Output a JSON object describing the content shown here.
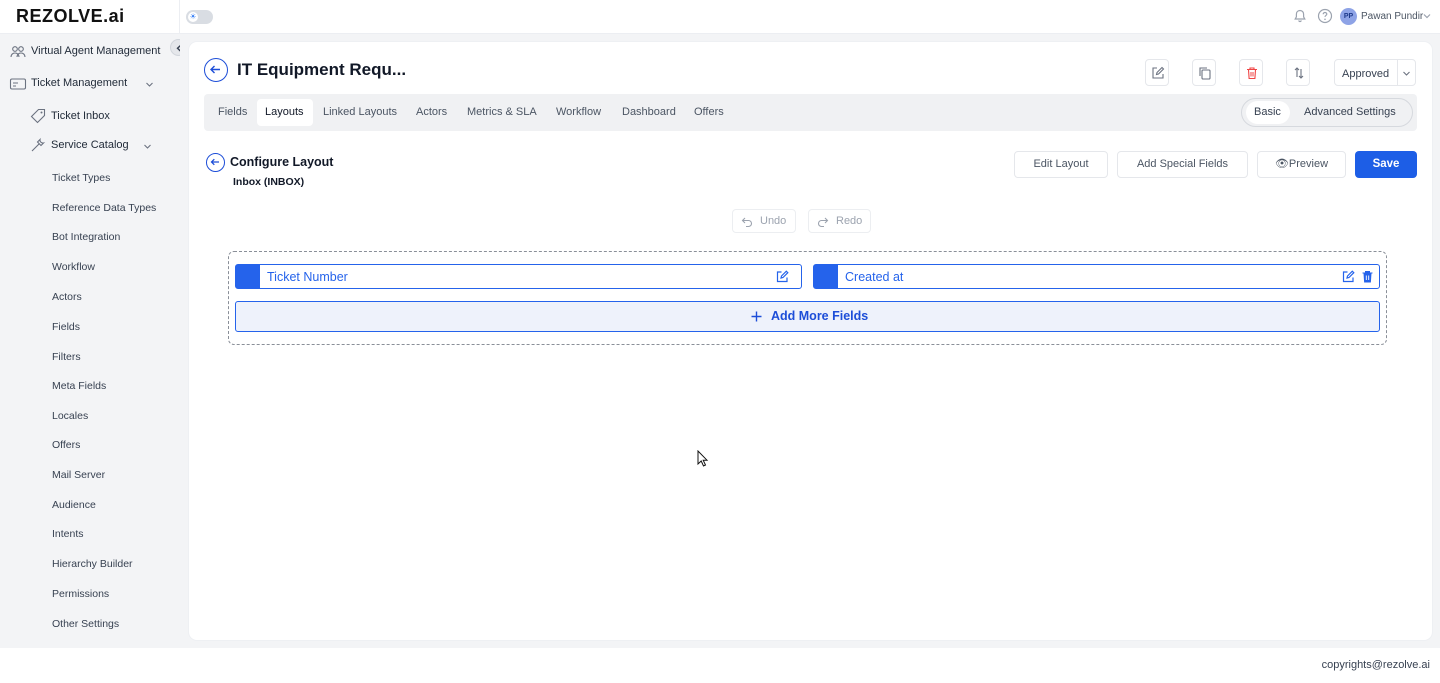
{
  "brand": {
    "logo": "REZOLVE.ai"
  },
  "topbar": {
    "user_initials": "PP",
    "user_name": "Pawan Pundir"
  },
  "sidebar": {
    "sections": [
      {
        "label": "Virtual Agent Management"
      },
      {
        "label": "Ticket Management"
      }
    ],
    "ticket_inbox": "Ticket Inbox",
    "service_catalog": "Service Catalog",
    "sub_items": [
      "Ticket Types",
      "Reference Data Types",
      "Bot Integration",
      "Workflow",
      "Actors",
      "Fields",
      "Filters",
      "Meta Fields",
      "Locales",
      "Offers",
      "Mail Server",
      "Audience",
      "Intents",
      "Hierarchy Builder",
      "Permissions",
      "Other Settings"
    ]
  },
  "header": {
    "title": "IT Equipment Requ...",
    "status": "Approved"
  },
  "tabs": [
    "Fields",
    "Layouts",
    "Linked Layouts",
    "Actors",
    "Metrics & SLA",
    "Workflow",
    "Dashboard",
    "Offers"
  ],
  "active_tab": "Layouts",
  "mode": {
    "basic": "Basic",
    "advanced": "Advanced Settings",
    "selected": "Basic"
  },
  "configure": {
    "title": "Configure Layout",
    "subtitle": "Inbox (INBOX)",
    "edit_layout": "Edit Layout",
    "add_special_fields": "Add Special Fields",
    "preview": "Preview",
    "save": "Save",
    "undo": "Undo",
    "redo": "Redo"
  },
  "layout_fields": [
    {
      "name": "Ticket Number"
    },
    {
      "name": "Created at"
    }
  ],
  "add_more_fields": "Add More Fields",
  "colors": {
    "primary": "#1d5ee6",
    "delete": "#ef4444"
  },
  "footer": {
    "copyright": "copyrights@rezolve.ai"
  }
}
